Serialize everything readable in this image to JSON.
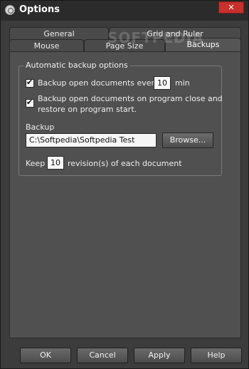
{
  "window": {
    "title": "Options",
    "close_label": "✕"
  },
  "tabs": {
    "row1": [
      {
        "label": "General"
      },
      {
        "label": "Grid and Ruler"
      }
    ],
    "row2": [
      {
        "label": "Mouse"
      },
      {
        "label": "Page Size"
      },
      {
        "label": "Backups"
      }
    ],
    "active": "Backups"
  },
  "watermark": "SOFTPEDIA",
  "backup": {
    "group_title": "Automatic backup options",
    "every": {
      "checked": true,
      "label_before": "Backup open documents every",
      "value": "10",
      "label_after": "min"
    },
    "on_close": {
      "checked": true,
      "line1": "Backup open documents on program close and",
      "line2": "restore on program start."
    },
    "folder_label": "Backup",
    "folder_value": "C:\\Softpedia\\Softpedia Test",
    "browse_label": "Browse...",
    "keep": {
      "label_before": "Keep",
      "value": "10",
      "label_after": "revision(s) of each document"
    }
  },
  "buttons": {
    "ok": "OK",
    "cancel": "Cancel",
    "apply": "Apply",
    "help": "Help"
  },
  "colors": {
    "close_button": "#c7302b",
    "background": "#3c3c3c",
    "panel": "#505050"
  },
  "icons": {
    "app": "options-app-icon",
    "check": "checkmark-icon"
  }
}
